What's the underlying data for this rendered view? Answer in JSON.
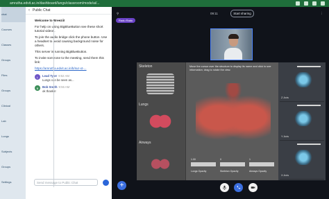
{
  "browser": {
    "url": "amrutha.edvit.ac.in/dashboard/lungs/classroom/mode/ai/..."
  },
  "leftnav": {
    "items": [
      "chat",
      "Courses",
      "Classes",
      "Groups",
      "Files",
      "Groups",
      "Clinical",
      "Lab",
      "Lungs",
      "Subjects",
      "Groups",
      "Settings"
    ]
  },
  "chat": {
    "title": "Public Chat",
    "welcome": [
      "Welcome to Breezii!",
      "For help on using BigBlueButton see these short tutorial videos.",
      "To join the audio bridge click the phone button. Use a headset to avoid causing background noise for others.",
      "This server is running BigBlueButton."
    ],
    "invite": "To invite someone to the meeting, send them this link:",
    "link": "https://amrutha.edvit.ac.in/b/sur-xt-...",
    "messages": [
      {
        "initial": "L",
        "name": "Lead Tyler",
        "time": "9:52 AM",
        "text": "Lungs can be seen as..."
      },
      {
        "initial": "B",
        "name": "Bob Smith",
        "time": "9:55 AM",
        "text": "ok thanks!"
      }
    ],
    "input_placeholder": "Send message to Public Chat"
  },
  "stage": {
    "timer": "09:11",
    "share_label": "Start sharing",
    "badge": "Radu Radu"
  },
  "viz": {
    "left_labels": [
      "Skeleton",
      "Lungs",
      "Airways"
    ],
    "description": "Move the cursor over the structure to display its name and click to see information; drag to rotate the view.",
    "slider_numbers": [
      "1.00",
      "0",
      "1"
    ],
    "slider_labels": [
      "Lungs Opacity",
      "Skeleton Opacity",
      "Airways Opacity"
    ],
    "axes": [
      "Z Axis",
      "Y Axis",
      "X Axis"
    ]
  },
  "controls": [
    "mic",
    "phone",
    "camera"
  ]
}
